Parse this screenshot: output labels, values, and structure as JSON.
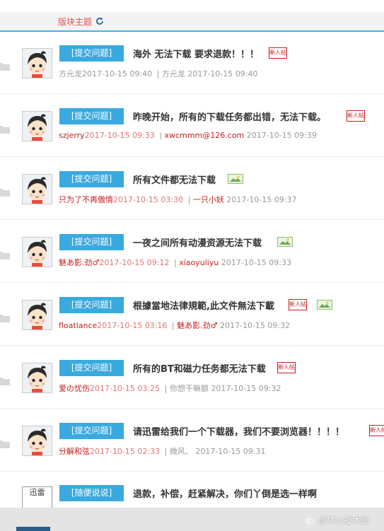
{
  "header": {
    "title": "版块主题",
    "refresh_icon": "refresh-icon"
  },
  "colors": {
    "accent": "#39a9e0",
    "author_red": "#c81d1d",
    "border_blue": "#3db3e6"
  },
  "badges": {
    "new_post": "新人帖"
  },
  "threads": [
    {
      "tag": "[提交问题]",
      "title": "海外 无法下载 要求退款！！！",
      "author": "方元龙",
      "post_time": "2017-10-15 09:40",
      "last_user": "方元龙",
      "last_time": "2017-10-15 09:40",
      "new_badge": true,
      "image_icon": false,
      "author_gray": true
    },
    {
      "tag": "[提交问题]",
      "title": "昨晚开始，所有的下载任务都出错，无法下载。",
      "author": "szjerry",
      "post_time": "2017-10-15 09:33",
      "last_user": "xwcmmm@126.com",
      "last_time": "2017-10-15 09:39",
      "new_badge": true,
      "image_icon": false,
      "author_gray": false
    },
    {
      "tag": "[提交问题]",
      "title": "所有文件都无法下载",
      "author": "只为了不再傲情",
      "post_time": "2017-10-15 03:30",
      "last_user": "一只小妖",
      "last_time": "2017-10-15 09:37",
      "new_badge": false,
      "image_icon": true,
      "author_gray": false
    },
    {
      "tag": "[提交问题]",
      "title": "一夜之间所有动漫资源无法下载",
      "author": "魅あ影.劲♂",
      "post_time": "2017-10-15 09:12",
      "last_user": "xiaoyuliyu",
      "last_time": "2017-10-15 09:33",
      "new_badge": false,
      "image_icon": true,
      "author_gray": false
    },
    {
      "tag": "[提交问题]",
      "title": "根據當地法律規範,此文件無法下載",
      "author": "floatlance",
      "post_time": "2017-10-15 03:16",
      "last_user": "魅あ影.劲♂",
      "last_time": "2017-10-15 09:32",
      "new_badge": true,
      "image_icon": true,
      "author_gray": false
    },
    {
      "tag": "[提交问题]",
      "title": "所有的BT和磁力任务都无法下载",
      "author": "爱の忧伤",
      "post_time": "2017-10-15 03:25",
      "last_user": "你想干嘛额",
      "last_time": "2017-10-15 09:32",
      "new_badge": true,
      "image_icon": false,
      "author_gray": false
    },
    {
      "tag": "[提交问题]",
      "title": "请迅雷给我们一个下载器，我们不要浏览器！！！！",
      "author": "分解和弦",
      "post_time": "2017-10-15 02:33",
      "last_user": "微风、",
      "last_time": "2017-10-15 09:31",
      "new_badge": true,
      "image_icon": false,
      "author_gray": false
    }
  ],
  "last_thread": {
    "tag": "[随便说说]",
    "title": "退款，补偿，赶紧解决，你们丫倒是选一样啊",
    "avatar_text": "迅雷"
  },
  "watermark": "@Mac技术组"
}
